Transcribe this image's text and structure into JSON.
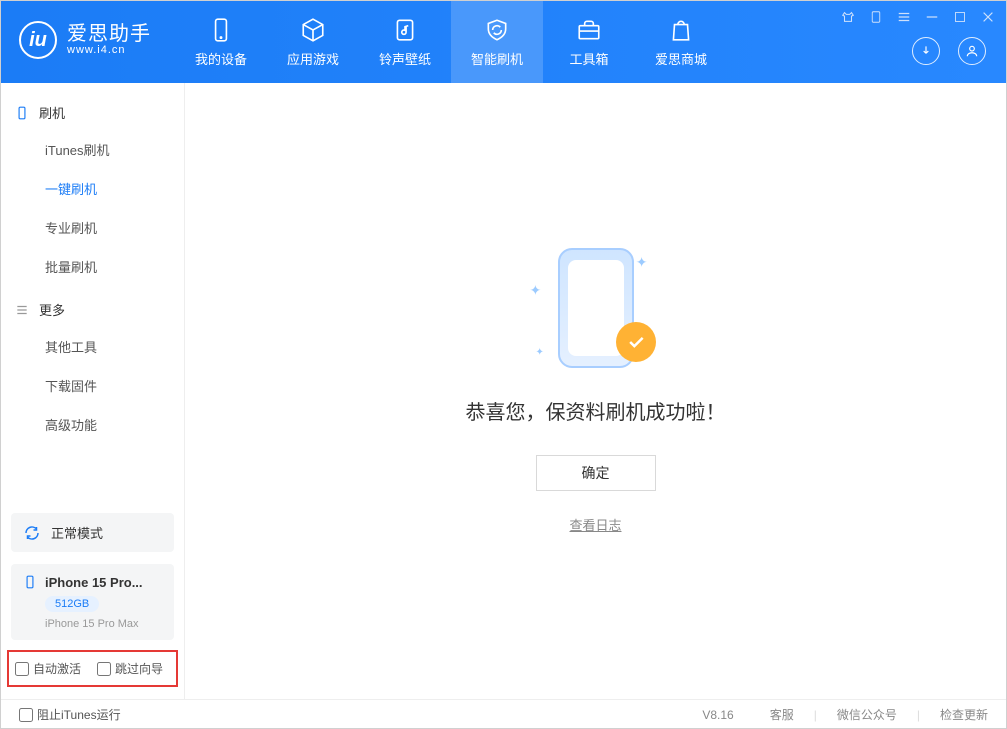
{
  "app": {
    "name": "爱思助手",
    "url": "www.i4.cn"
  },
  "nav": [
    {
      "label": "我的设备"
    },
    {
      "label": "应用游戏"
    },
    {
      "label": "铃声壁纸"
    },
    {
      "label": "智能刷机"
    },
    {
      "label": "工具箱"
    },
    {
      "label": "爱思商城"
    }
  ],
  "sidebar": {
    "group1": {
      "title": "刷机",
      "items": [
        {
          "label": "iTunes刷机"
        },
        {
          "label": "一键刷机"
        },
        {
          "label": "专业刷机"
        },
        {
          "label": "批量刷机"
        }
      ]
    },
    "group2": {
      "title": "更多",
      "items": [
        {
          "label": "其他工具"
        },
        {
          "label": "下载固件"
        },
        {
          "label": "高级功能"
        }
      ]
    },
    "mode": "正常模式",
    "device": {
      "name": "iPhone 15 Pro...",
      "storage": "512GB",
      "model": "iPhone 15 Pro Max"
    },
    "checks": {
      "auto_activate": "自动激活",
      "skip_wizard": "跳过向导"
    }
  },
  "main": {
    "success_text": "恭喜您，保资料刷机成功啦！",
    "ok_button": "确定",
    "view_log": "查看日志"
  },
  "footer": {
    "block_itunes": "阻止iTunes运行",
    "version": "V8.16",
    "links": [
      "客服",
      "微信公众号",
      "检查更新"
    ]
  }
}
